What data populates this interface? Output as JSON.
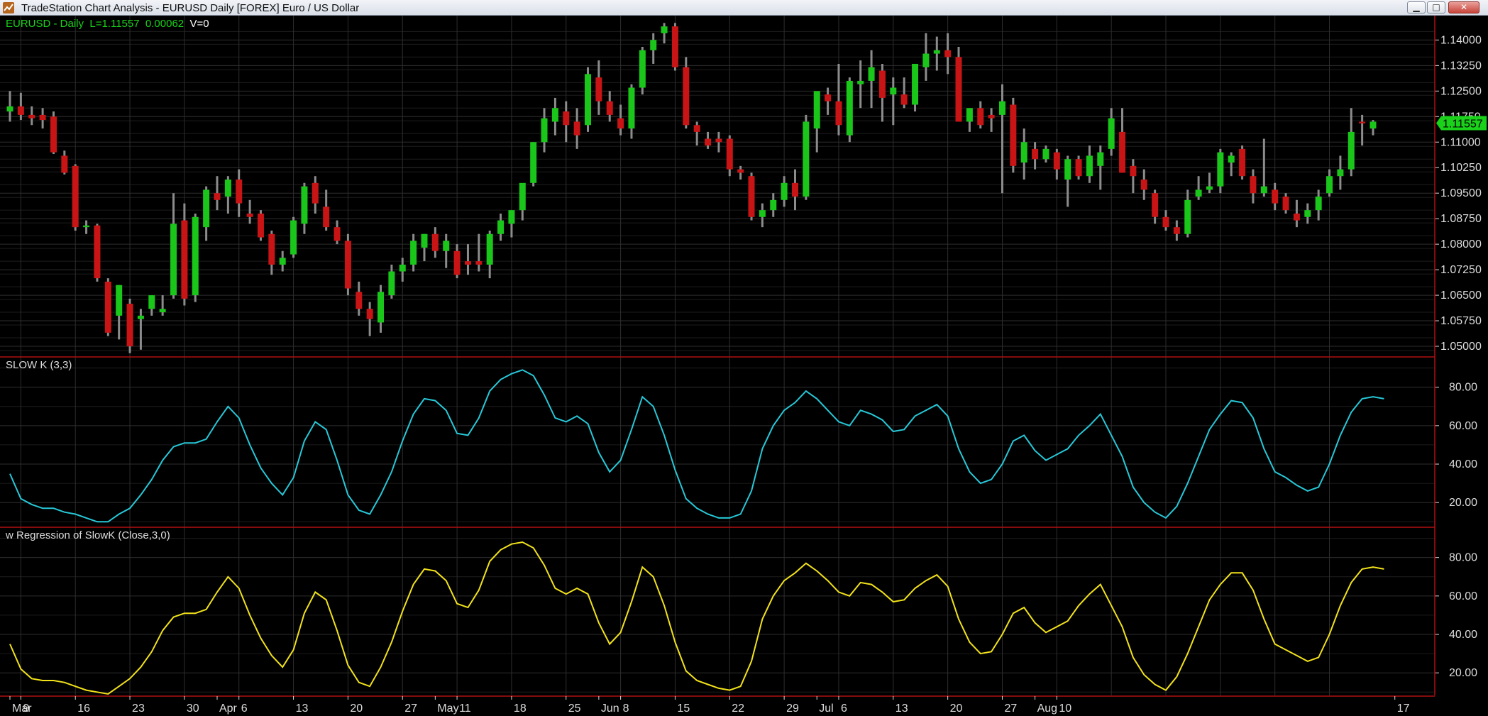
{
  "window": {
    "title": "TradeStation Chart Analysis - EURUSD Daily [FOREX] Euro / US Dollar",
    "minimize_glyph": "▁",
    "maximize_glyph": "□",
    "close_glyph": "✕"
  },
  "colors": {
    "background": "#000000",
    "grid": "#2e2e2e",
    "up_candle": "#19c619",
    "down_candle": "#c81414",
    "wick": "#8c8c8c",
    "slowk_line": "#27c8d8",
    "regression_line": "#f2e21a",
    "separator": "#b01010",
    "axis_text": "#dcdcdc",
    "last_price_tag": "#19d219"
  },
  "price_panel": {
    "symbol": "EURUSD - Daily",
    "last_label": "L=1.11557",
    "change": "0.00062",
    "volume_label": "V=0",
    "last_price_tag": "1.11557",
    "y_ticks": [
      "1.14000",
      "1.13250",
      "1.12500",
      "1.11750",
      "1.11000",
      "1.10250",
      "1.09500",
      "1.08750",
      "1.08000",
      "1.07250",
      "1.06500",
      "1.05750",
      "1.05000"
    ]
  },
  "slowk_panel": {
    "title": "SLOW K  (3,3)",
    "y_ticks": [
      "80.00",
      "60.00",
      "40.00",
      "20.00"
    ]
  },
  "regression_panel": {
    "title": "w Regression of SlowK (Close,3,0)",
    "y_ticks": [
      "80.00",
      "60.00",
      "40.00",
      "20.00"
    ]
  },
  "x_axis_labels": [
    "Mar",
    "9",
    "16",
    "23",
    "30",
    "Apr",
    "6",
    "13",
    "20",
    "27",
    "May",
    "11",
    "18",
    "25",
    "Jun",
    "8",
    "15",
    "22",
    "29",
    "Jul",
    "6",
    "13",
    "20",
    "27",
    "Aug",
    "10",
    "17"
  ],
  "chart_data": [
    {
      "type": "candlestick",
      "title": "EURUSD - Daily",
      "ylim": [
        1.0475,
        1.1455
      ],
      "x_labels": [
        "Mar",
        "9",
        "16",
        "23",
        "30",
        "Apr",
        "6",
        "13",
        "20",
        "27",
        "May",
        "11",
        "18",
        "25",
        "Jun",
        "8",
        "15",
        "22",
        "29",
        "Jul",
        "6",
        "13",
        "20",
        "27",
        "Aug",
        "10",
        "17"
      ],
      "ohlc": [
        [
          1.119,
          1.125,
          1.116,
          1.1205
        ],
        [
          1.1205,
          1.1245,
          1.1165,
          1.118
        ],
        [
          1.118,
          1.1205,
          1.115,
          1.117
        ],
        [
          1.118,
          1.12,
          1.114,
          1.1165
        ],
        [
          1.1175,
          1.119,
          1.1065,
          1.107
        ],
        [
          1.106,
          1.1075,
          1.1005,
          1.101
        ],
        [
          1.103,
          1.1035,
          1.084,
          1.085
        ],
        [
          1.085,
          1.087,
          1.083,
          1.0855
        ],
        [
          1.0855,
          1.086,
          1.069,
          1.07
        ],
        [
          1.069,
          1.07,
          1.053,
          1.054
        ],
        [
          1.059,
          1.068,
          1.052,
          1.068
        ],
        [
          1.0625,
          1.064,
          1.048,
          1.05
        ],
        [
          1.058,
          1.061,
          1.049,
          1.059
        ],
        [
          1.061,
          1.065,
          1.059,
          1.065
        ],
        [
          1.06,
          1.065,
          1.059,
          1.061
        ],
        [
          1.065,
          1.095,
          1.064,
          1.086
        ],
        [
          1.087,
          1.092,
          1.062,
          1.064
        ],
        [
          1.065,
          1.089,
          1.063,
          1.088
        ],
        [
          1.085,
          1.097,
          1.081,
          1.096
        ],
        [
          1.095,
          1.1,
          1.09,
          1.093
        ],
        [
          1.094,
          1.1,
          1.089,
          1.099
        ],
        [
          1.099,
          1.102,
          1.088,
          1.092
        ],
        [
          1.089,
          1.093,
          1.086,
          1.088
        ],
        [
          1.089,
          1.09,
          1.081,
          1.082
        ],
        [
          1.083,
          1.084,
          1.071,
          1.074
        ],
        [
          1.074,
          1.078,
          1.072,
          1.076
        ],
        [
          1.077,
          1.088,
          1.076,
          1.087
        ],
        [
          1.086,
          1.098,
          1.083,
          1.097
        ],
        [
          1.098,
          1.1,
          1.089,
          1.092
        ],
        [
          1.091,
          1.096,
          1.084,
          1.085
        ],
        [
          1.085,
          1.087,
          1.08,
          1.081
        ],
        [
          1.081,
          1.083,
          1.065,
          1.067
        ],
        [
          1.066,
          1.069,
          1.059,
          1.061
        ],
        [
          1.061,
          1.063,
          1.053,
          1.058
        ],
        [
          1.057,
          1.068,
          1.054,
          1.066
        ],
        [
          1.065,
          1.074,
          1.064,
          1.072
        ],
        [
          1.072,
          1.076,
          1.069,
          1.074
        ],
        [
          1.074,
          1.083,
          1.072,
          1.081
        ],
        [
          1.079,
          1.083,
          1.075,
          1.083
        ],
        [
          1.083,
          1.085,
          1.076,
          1.078
        ],
        [
          1.078,
          1.083,
          1.073,
          1.081
        ],
        [
          1.078,
          1.08,
          1.07,
          1.071
        ],
        [
          1.075,
          1.08,
          1.071,
          1.074
        ],
        [
          1.075,
          1.083,
          1.072,
          1.074
        ],
        [
          1.074,
          1.084,
          1.07,
          1.083
        ],
        [
          1.083,
          1.089,
          1.081,
          1.087
        ],
        [
          1.086,
          1.09,
          1.082,
          1.09
        ],
        [
          1.09,
          1.096,
          1.087,
          1.098
        ],
        [
          1.098,
          1.11,
          1.097,
          1.11
        ],
        [
          1.11,
          1.12,
          1.107,
          1.117
        ],
        [
          1.116,
          1.123,
          1.112,
          1.12
        ],
        [
          1.119,
          1.122,
          1.11,
          1.115
        ],
        [
          1.116,
          1.12,
          1.108,
          1.112
        ],
        [
          1.115,
          1.132,
          1.113,
          1.13
        ],
        [
          1.129,
          1.134,
          1.118,
          1.122
        ],
        [
          1.122,
          1.125,
          1.116,
          1.118
        ],
        [
          1.117,
          1.121,
          1.112,
          1.114
        ],
        [
          1.114,
          1.127,
          1.111,
          1.126
        ],
        [
          1.126,
          1.138,
          1.124,
          1.137
        ],
        [
          1.137,
          1.142,
          1.133,
          1.14
        ],
        [
          1.142,
          1.145,
          1.139,
          1.144
        ],
        [
          1.144,
          1.145,
          1.131,
          1.132
        ],
        [
          1.132,
          1.135,
          1.114,
          1.115
        ],
        [
          1.115,
          1.116,
          1.109,
          1.113
        ],
        [
          1.111,
          1.113,
          1.108,
          1.109
        ],
        [
          1.111,
          1.113,
          1.107,
          1.11
        ],
        [
          1.111,
          1.112,
          1.1,
          1.102
        ],
        [
          1.102,
          1.103,
          1.099,
          1.101
        ],
        [
          1.1,
          1.101,
          1.087,
          1.088
        ],
        [
          1.088,
          1.092,
          1.085,
          1.09
        ],
        [
          1.09,
          1.095,
          1.088,
          1.093
        ],
        [
          1.093,
          1.1,
          1.091,
          1.098
        ],
        [
          1.098,
          1.102,
          1.09,
          1.094
        ],
        [
          1.094,
          1.118,
          1.093,
          1.116
        ],
        [
          1.114,
          1.124,
          1.107,
          1.125
        ],
        [
          1.124,
          1.126,
          1.118,
          1.122
        ],
        [
          1.122,
          1.133,
          1.112,
          1.115
        ],
        [
          1.112,
          1.129,
          1.11,
          1.128
        ],
        [
          1.127,
          1.134,
          1.12,
          1.128
        ],
        [
          1.128,
          1.137,
          1.12,
          1.132
        ],
        [
          1.131,
          1.133,
          1.116,
          1.123
        ],
        [
          1.124,
          1.129,
          1.115,
          1.126
        ],
        [
          1.124,
          1.129,
          1.12,
          1.121
        ],
        [
          1.121,
          1.132,
          1.119,
          1.133
        ],
        [
          1.132,
          1.142,
          1.128,
          1.136
        ],
        [
          1.136,
          1.141,
          1.131,
          1.137
        ],
        [
          1.137,
          1.142,
          1.13,
          1.135
        ],
        [
          1.135,
          1.138,
          1.116,
          1.116
        ],
        [
          1.116,
          1.12,
          1.113,
          1.12
        ],
        [
          1.12,
          1.122,
          1.114,
          1.115
        ],
        [
          1.118,
          1.12,
          1.113,
          1.117
        ],
        [
          1.118,
          1.127,
          1.095,
          1.122
        ],
        [
          1.121,
          1.123,
          1.101,
          1.103
        ],
        [
          1.104,
          1.114,
          1.099,
          1.11
        ],
        [
          1.108,
          1.11,
          1.102,
          1.105
        ],
        [
          1.105,
          1.109,
          1.104,
          1.108
        ],
        [
          1.107,
          1.108,
          1.099,
          1.102
        ],
        [
          1.099,
          1.106,
          1.091,
          1.105
        ],
        [
          1.105,
          1.106,
          1.099,
          1.1
        ],
        [
          1.1,
          1.109,
          1.098,
          1.106
        ],
        [
          1.103,
          1.109,
          1.096,
          1.107
        ],
        [
          1.108,
          1.12,
          1.106,
          1.117
        ],
        [
          1.113,
          1.12,
          1.101,
          1.101
        ],
        [
          1.103,
          1.105,
          1.095,
          1.1
        ],
        [
          1.099,
          1.102,
          1.093,
          1.096
        ],
        [
          1.095,
          1.096,
          1.086,
          1.088
        ],
        [
          1.088,
          1.09,
          1.084,
          1.085
        ],
        [
          1.085,
          1.087,
          1.081,
          1.083
        ],
        [
          1.083,
          1.096,
          1.082,
          1.093
        ],
        [
          1.094,
          1.1,
          1.093,
          1.096
        ],
        [
          1.096,
          1.101,
          1.095,
          1.097
        ],
        [
          1.097,
          1.108,
          1.095,
          1.107
        ],
        [
          1.104,
          1.107,
          1.1,
          1.106
        ],
        [
          1.108,
          1.109,
          1.099,
          1.1
        ],
        [
          1.1,
          1.102,
          1.092,
          1.095
        ],
        [
          1.095,
          1.111,
          1.094,
          1.097
        ],
        [
          1.096,
          1.098,
          1.09,
          1.092
        ],
        [
          1.094,
          1.095,
          1.089,
          1.09
        ],
        [
          1.089,
          1.093,
          1.085,
          1.087
        ],
        [
          1.088,
          1.092,
          1.086,
          1.09
        ],
        [
          1.09,
          1.096,
          1.087,
          1.094
        ],
        [
          1.095,
          1.102,
          1.094,
          1.1
        ],
        [
          1.1,
          1.106,
          1.096,
          1.102
        ],
        [
          1.102,
          1.12,
          1.1,
          1.113
        ],
        [
          1.116,
          1.118,
          1.109,
          1.1155
        ],
        [
          1.114,
          1.1165,
          1.112,
          1.116
        ]
      ]
    },
    {
      "type": "line",
      "title": "SLOW K  (3,3)",
      "ylim": [
        9,
        88
      ],
      "series": [
        {
          "values": [
            35,
            22,
            19,
            17,
            17,
            15,
            14,
            12,
            10,
            10,
            14,
            17,
            24,
            32,
            42,
            49,
            51,
            51,
            53,
            62,
            70,
            64,
            50,
            38,
            30,
            24,
            33,
            52,
            62,
            58,
            42,
            24,
            16,
            14,
            24,
            36,
            52,
            66,
            74,
            73,
            68,
            56,
            55,
            64,
            78,
            84,
            87,
            89,
            86,
            76,
            64,
            62,
            65,
            61,
            46,
            36,
            42,
            58,
            75,
            70,
            55,
            37,
            22,
            17,
            14,
            12,
            12,
            14,
            26,
            48,
            60,
            68,
            72,
            78,
            74,
            68,
            62,
            60,
            68,
            66,
            63,
            57,
            58,
            65,
            68,
            71,
            65,
            48,
            36,
            30,
            32,
            40,
            52,
            55,
            47,
            42,
            45,
            48,
            55,
            60,
            66,
            55,
            44,
            28,
            20,
            15,
            12,
            18,
            30,
            44,
            58,
            66,
            73,
            72,
            64,
            48,
            36,
            33,
            29,
            26,
            28,
            40,
            55,
            67,
            74,
            75,
            74
          ]
        }
      ]
    },
    {
      "type": "line",
      "title": "w Regression of SlowK (Close,3,0)",
      "ylim": [
        9,
        88
      ],
      "series": [
        {
          "values": [
            35,
            22,
            17,
            16,
            16,
            15,
            13,
            11,
            10,
            9,
            13,
            17,
            23,
            31,
            42,
            49,
            51,
            51,
            53,
            62,
            70,
            64,
            50,
            38,
            29,
            23,
            32,
            51,
            62,
            58,
            42,
            24,
            15,
            13,
            23,
            36,
            52,
            66,
            74,
            73,
            68,
            56,
            54,
            63,
            78,
            84,
            87,
            88,
            85,
            76,
            64,
            61,
            64,
            61,
            46,
            35,
            41,
            57,
            75,
            70,
            55,
            36,
            21,
            16,
            14,
            12,
            11,
            13,
            26,
            48,
            60,
            68,
            72,
            77,
            73,
            68,
            62,
            60,
            67,
            66,
            62,
            57,
            58,
            64,
            68,
            71,
            65,
            48,
            36,
            30,
            31,
            40,
            51,
            54,
            46,
            41,
            44,
            47,
            55,
            61,
            66,
            55,
            44,
            28,
            19,
            14,
            11,
            18,
            30,
            44,
            58,
            66,
            72,
            72,
            63,
            48,
            35,
            32,
            29,
            26,
            28,
            40,
            55,
            67,
            74,
            75,
            74
          ]
        }
      ]
    }
  ]
}
